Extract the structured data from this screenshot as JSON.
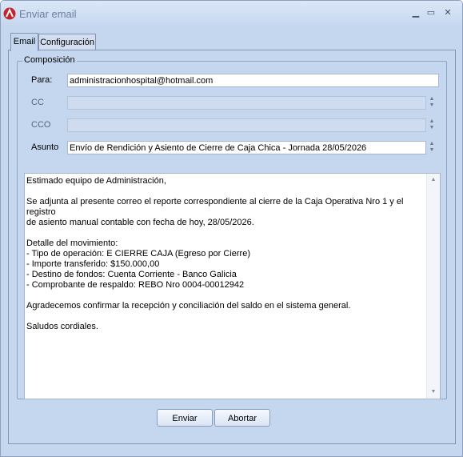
{
  "window": {
    "title": "Enviar email",
    "min_glyph": "▁",
    "max_glyph": "▭",
    "close_glyph": "✕"
  },
  "tabs": [
    {
      "label": "Email",
      "active": true
    },
    {
      "label": "Configuración",
      "active": false
    }
  ],
  "composition": {
    "group_title": "Composición",
    "to": {
      "label": "Para:",
      "value": "administracionhospital@hotmail.com"
    },
    "cc": {
      "label": "CC",
      "value": ""
    },
    "bcc": {
      "label": "CCO",
      "value": ""
    },
    "subject": {
      "label": "Asunto",
      "value": "Envío de Rendición y Asiento de Cierre de Caja Chica - Jornada 28/05/2026"
    },
    "body": "Estimado equipo de Administración,\n\nSe adjunta al presente correo el reporte correspondiente al cierre de la Caja Operativa Nro 1 y el registro\nde asiento manual contable con fecha de hoy, 28/05/2026.\n\nDetalle del movimiento:\n- Tipo de operación: E CIERRE CAJA (Egreso por Cierre)\n- Importe transferido: $150.000,00\n- Destino de fondos: Cuenta Corriente - Banco Galicia\n- Comprobante de respaldo: REBO Nro 0004-00012942\n\nAgradecemos confirmar la recepción y conciliación del saldo en el sistema general.\n\nSaludos cordiales."
  },
  "buttons": {
    "send": "Enviar",
    "cancel": "Abortar"
  },
  "colors": {
    "window_bg": "#c5d6ef",
    "app_icon": "#c0262c"
  }
}
